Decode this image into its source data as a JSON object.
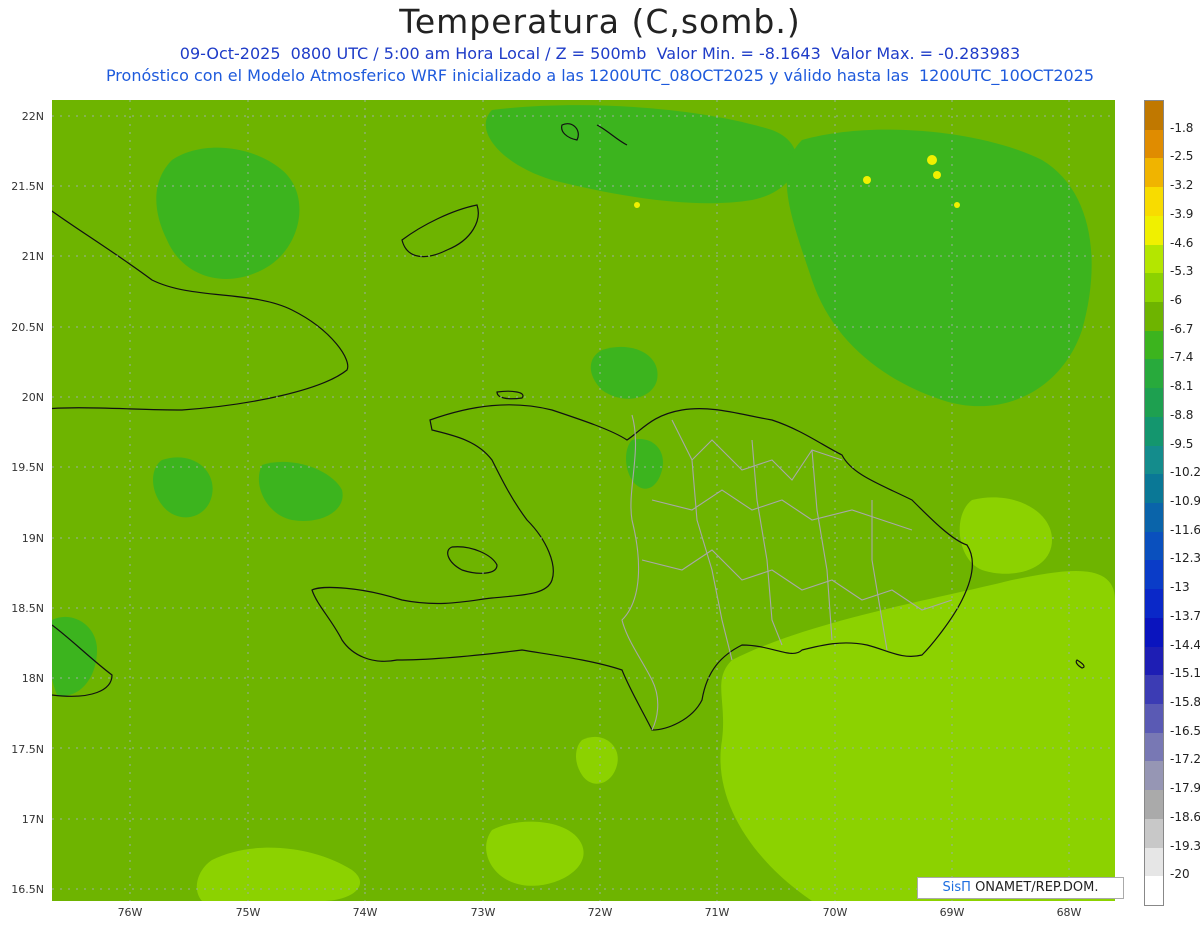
{
  "title": "Temperatura (C,somb.)",
  "subtitle1": "09-Oct-2025  0800 UTC / 5:00 am Hora Local / Z = 500mb  Valor Min. = -8.1643  Valor Max. = -0.283983",
  "subtitle2": "Pronóstico con el Modelo Atmosferico WRF inicializado a las 1200UTC_08OCT2025 y válido hasta las  1200UTC_10OCT2025",
  "credit": {
    "brand": "SisΠ",
    "text": " ONAMET/REP.DOM."
  },
  "axes": {
    "lat_labels": [
      "22N",
      "21.5N",
      "21N",
      "20.5N",
      "20N",
      "19.5N",
      "19N",
      "18.5N",
      "18N",
      "17.5N",
      "17N",
      "16.5N"
    ],
    "lon_labels": [
      "76W",
      "75W",
      "74W",
      "73W",
      "72W",
      "71W",
      "70W",
      "69W",
      "68W"
    ]
  },
  "colorbar": {
    "labels": [
      "-1.8",
      "-2.5",
      "-3.2",
      "-3.9",
      "-4.6",
      "-5.3",
      "-6",
      "-6.7",
      "-7.4",
      "-8.1",
      "-8.8",
      "-9.5",
      "-10.2",
      "-10.9",
      "-11.6",
      "-12.3",
      "-13",
      "-13.7",
      "-14.4",
      "-15.1",
      "-15.8",
      "-16.5",
      "-17.2",
      "-17.9",
      "-18.6",
      "-19.3",
      "-20"
    ],
    "colors": [
      "#c07800",
      "#e08c00",
      "#f0b400",
      "#f8dc00",
      "#f0f000",
      "#b4e600",
      "#8cd200",
      "#6eb400",
      "#3cb41e",
      "#28aa3c",
      "#1ea050",
      "#14966e",
      "#148c8c",
      "#0a7896",
      "#0a64aa",
      "#0a50be",
      "#0a3cc8",
      "#0a28c8",
      "#0a14be",
      "#1e1eb4",
      "#3c3cb4",
      "#5a5ab4",
      "#7878b4",
      "#9696b4",
      "#aaaaaa",
      "#c8c8c8",
      "#e6e6e6",
      "#ffffff"
    ]
  },
  "field_colors": {
    "base": "#6eb400",
    "cool": "#3cb41e",
    "warm": "#8cd200",
    "hot": "#f0f000"
  }
}
